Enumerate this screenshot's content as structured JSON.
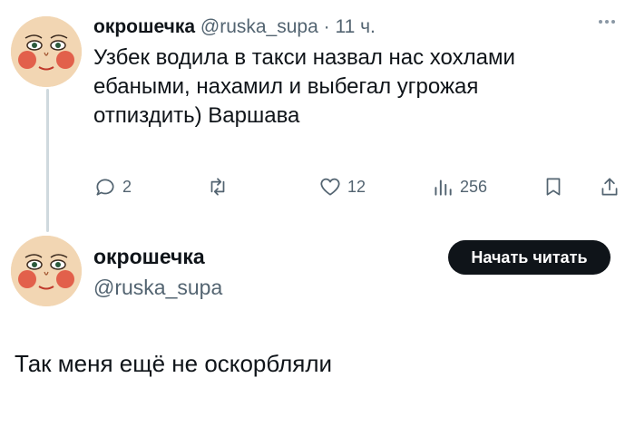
{
  "reply": {
    "display_name": "окрошечка",
    "handle": "@ruska_supa",
    "separator": "·",
    "time": "11 ч.",
    "text": "Узбек водила в такси назвал нас хохлами\nебаными, нахамил и выбегал угрожая\nотпиздить) Варшава",
    "actions": {
      "replies": "2",
      "reposts": "",
      "likes": "12",
      "views": "256"
    }
  },
  "main": {
    "display_name": "окрошечка",
    "handle": "@ruska_supa",
    "follow_label": "Начать читать",
    "text": "Так меня ещё не оскорбляли"
  },
  "icons": {
    "more": "more-horizontal-icon",
    "reply": "reply-icon",
    "repost": "repost-icon",
    "like": "heart-icon",
    "views": "views-icon",
    "bookmark": "bookmark-icon",
    "share": "share-icon"
  },
  "colors": {
    "text": "#0f1419",
    "secondary": "#536471",
    "thread_line": "#cfd9de",
    "button_bg": "#0f1419",
    "button_text": "#ffffff"
  }
}
